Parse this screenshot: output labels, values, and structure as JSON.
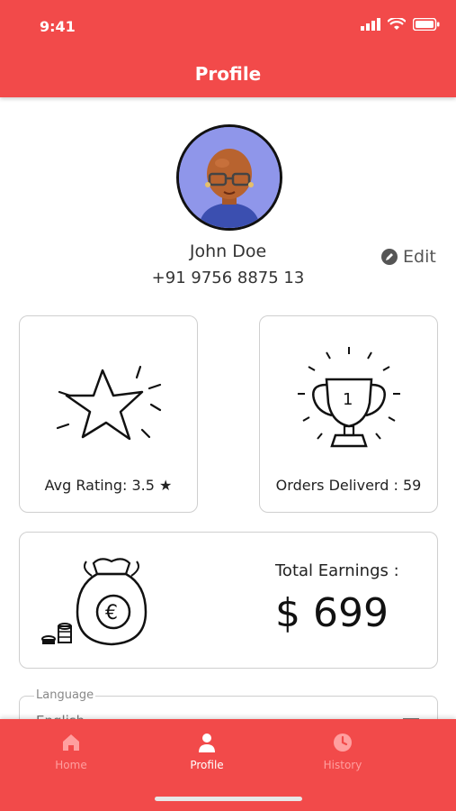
{
  "status": {
    "time": "9:41"
  },
  "header": {
    "title": "Profile"
  },
  "profile": {
    "name": "John Doe",
    "phone": "+91 9756 8875 13",
    "edit_label": "Edit"
  },
  "stats": {
    "rating_label": "Avg Rating: 3.5 ★",
    "orders_label": "Orders Deliverd : 59",
    "trophy_number": "1",
    "earnings_label": "Total Earnings :",
    "earnings_value": "$ 699"
  },
  "language": {
    "label": "Language",
    "value": "English"
  },
  "nav": {
    "home": "Home",
    "profile": "Profile",
    "history": "History",
    "active": "Profile"
  },
  "colors": {
    "brand": "#f24a4a",
    "nav_inactive": "#ff9f9f",
    "avatar_bg": "#8f96ea"
  }
}
